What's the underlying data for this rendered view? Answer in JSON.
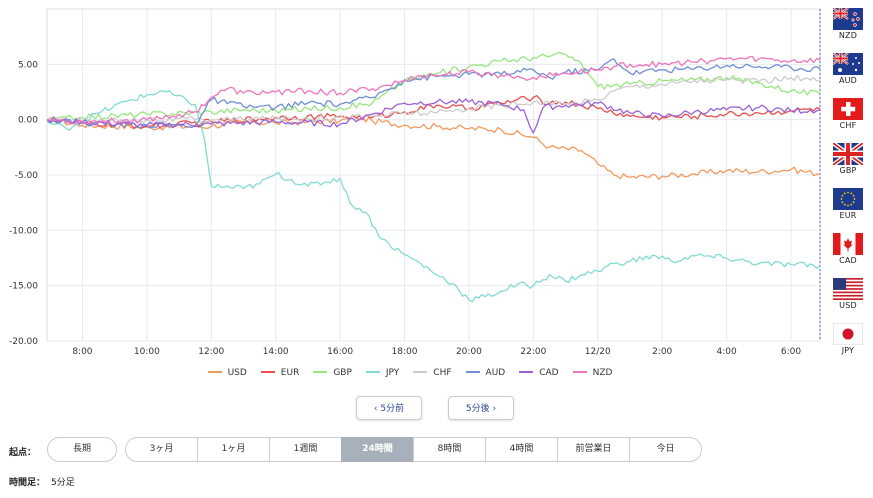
{
  "chart_data": {
    "type": "line",
    "ylim": [
      -20,
      10
    ],
    "y_ticks": [
      "5.00",
      "0.00",
      "-5.00",
      "-10.00",
      "-15.00",
      "-20.00"
    ],
    "y_tick_values": [
      5,
      0,
      -5,
      -10,
      -15,
      -20
    ],
    "x_ticks": [
      "8:00",
      "10:00",
      "12:00",
      "14:00",
      "16:00",
      "18:00",
      "20:00",
      "22:00",
      "12/20",
      "2:00",
      "4:00",
      "6:00"
    ],
    "x_range_hours": [
      6.9,
      30.9
    ],
    "grid": true,
    "legend_position": "bottom",
    "series": [
      {
        "name": "USD",
        "color": "#f29a5e",
        "points": [
          [
            6.9,
            0
          ],
          [
            8,
            -0.5
          ],
          [
            10,
            -0.7
          ],
          [
            12,
            -0.6
          ],
          [
            13,
            -0.2
          ],
          [
            14,
            -0.3
          ],
          [
            15,
            -0.2
          ],
          [
            16,
            -0.1
          ],
          [
            16.5,
            0.2
          ],
          [
            17,
            -0.1
          ],
          [
            18,
            -0.5
          ],
          [
            19,
            -0.6
          ],
          [
            20,
            -0.8
          ],
          [
            21,
            -0.9
          ],
          [
            22,
            -1.6
          ],
          [
            22.5,
            -2.5
          ],
          [
            23.5,
            -2.8
          ],
          [
            24,
            -4.0
          ],
          [
            24.5,
            -5.0
          ],
          [
            25,
            -5.2
          ],
          [
            26,
            -5.1
          ],
          [
            27,
            -4.9
          ],
          [
            28,
            -4.6
          ],
          [
            29,
            -4.7
          ],
          [
            30,
            -4.5
          ],
          [
            30.9,
            -4.9
          ]
        ]
      },
      {
        "name": "EUR",
        "color": "#e84e4e",
        "points": [
          [
            6.9,
            0
          ],
          [
            8,
            -0.3
          ],
          [
            10,
            -0.6
          ],
          [
            12,
            -0.2
          ],
          [
            14,
            0.2
          ],
          [
            16,
            0.3
          ],
          [
            17,
            0.2
          ],
          [
            18,
            0.7
          ],
          [
            19,
            1.3
          ],
          [
            20,
            1.0
          ],
          [
            21,
            1.5
          ],
          [
            22,
            2.0
          ],
          [
            22.5,
            1.5
          ],
          [
            23,
            1.6
          ],
          [
            24,
            1.0
          ],
          [
            25,
            0.3
          ],
          [
            26,
            0.2
          ],
          [
            27,
            0.3
          ],
          [
            28,
            0.5
          ],
          [
            29,
            0.6
          ],
          [
            30,
            0.8
          ],
          [
            30.9,
            1.0
          ]
        ]
      },
      {
        "name": "GBP",
        "color": "#98e67f",
        "points": [
          [
            6.9,
            0
          ],
          [
            8,
            0.2
          ],
          [
            10,
            0.5
          ],
          [
            12,
            0.7
          ],
          [
            13,
            0.9
          ],
          [
            14,
            0.8
          ],
          [
            15,
            1.0
          ],
          [
            16,
            1.1
          ],
          [
            17,
            1.5
          ],
          [
            18,
            3.5
          ],
          [
            19,
            4.2
          ],
          [
            20,
            4.8
          ],
          [
            21,
            5.3
          ],
          [
            22,
            5.6
          ],
          [
            23,
            5.9
          ],
          [
            23.5,
            5.0
          ],
          [
            24,
            3.0
          ],
          [
            25,
            3.2
          ],
          [
            26,
            3.5
          ],
          [
            27,
            3.6
          ],
          [
            28,
            3.8
          ],
          [
            29,
            3.3
          ],
          [
            30,
            2.6
          ],
          [
            30.9,
            2.3
          ]
        ]
      },
      {
        "name": "JPY",
        "color": "#82dbd2",
        "points": [
          [
            6.9,
            -0.2
          ],
          [
            7.5,
            -0.8
          ],
          [
            8.5,
            0.6
          ],
          [
            9.5,
            1.8
          ],
          [
            10.5,
            2.6
          ],
          [
            11.5,
            1.4
          ],
          [
            11.8,
            -2.0
          ],
          [
            12,
            -6.0
          ],
          [
            13,
            -6.2
          ],
          [
            13.5,
            -5.8
          ],
          [
            14,
            -4.9
          ],
          [
            15,
            -6.0
          ],
          [
            16,
            -5.3
          ],
          [
            16.3,
            -7.5
          ],
          [
            16.8,
            -8.4
          ],
          [
            17.3,
            -10.8
          ],
          [
            18,
            -12.2
          ],
          [
            18.5,
            -13.0
          ],
          [
            19,
            -14.0
          ],
          [
            19.5,
            -14.8
          ],
          [
            20,
            -16.3
          ],
          [
            20.5,
            -16.0
          ],
          [
            21,
            -15.5
          ],
          [
            21.5,
            -14.9
          ],
          [
            22,
            -15.0
          ],
          [
            22.5,
            -14.0
          ],
          [
            23,
            -14.6
          ],
          [
            23.5,
            -14.0
          ],
          [
            24,
            -13.7
          ],
          [
            24.5,
            -13.0
          ],
          [
            25,
            -12.8
          ],
          [
            25.8,
            -12.3
          ],
          [
            26.3,
            -12.8
          ],
          [
            27,
            -12.3
          ],
          [
            28,
            -12.5
          ],
          [
            29,
            -13.0
          ],
          [
            30,
            -13.1
          ],
          [
            30.9,
            -13.2
          ]
        ]
      },
      {
        "name": "CHF",
        "color": "#cccccc",
        "points": [
          [
            6.9,
            0
          ],
          [
            8,
            -0.1
          ],
          [
            10,
            0.0
          ],
          [
            12,
            0.0
          ],
          [
            14,
            0.1
          ],
          [
            16,
            0.2
          ],
          [
            17,
            0.3
          ],
          [
            18,
            0.6
          ],
          [
            19,
            0.6
          ],
          [
            20,
            1.0
          ],
          [
            21,
            1.3
          ],
          [
            22,
            1.6
          ],
          [
            23,
            1.4
          ],
          [
            24,
            1.8
          ],
          [
            24.5,
            2.6
          ],
          [
            25,
            3.0
          ],
          [
            26,
            3.2
          ],
          [
            27,
            3.5
          ],
          [
            28,
            3.6
          ],
          [
            29,
            3.4
          ],
          [
            30,
            3.8
          ],
          [
            30.9,
            3.5
          ]
        ]
      },
      {
        "name": "AUD",
        "color": "#6f8fd6",
        "points": [
          [
            6.9,
            0
          ],
          [
            8,
            -0.3
          ],
          [
            10,
            -0.5
          ],
          [
            11.5,
            -0.5
          ],
          [
            12,
            1.8
          ],
          [
            13,
            1.2
          ],
          [
            14,
            1.1
          ],
          [
            15,
            1.5
          ],
          [
            16,
            1.4
          ],
          [
            17,
            2.0
          ],
          [
            18,
            3.6
          ],
          [
            19,
            3.9
          ],
          [
            20,
            4.1
          ],
          [
            21,
            4.1
          ],
          [
            22,
            4.5
          ],
          [
            22.5,
            3.8
          ],
          [
            23,
            4.3
          ],
          [
            24,
            4.5
          ],
          [
            24.5,
            5.5
          ],
          [
            25,
            4.2
          ],
          [
            26,
            4.5
          ],
          [
            27,
            4.6
          ],
          [
            28,
            4.9
          ],
          [
            29,
            4.8
          ],
          [
            30,
            4.7
          ],
          [
            30.9,
            4.6
          ]
        ]
      },
      {
        "name": "CAD",
        "color": "#9a62d6",
        "points": [
          [
            6.9,
            0
          ],
          [
            8,
            -0.2
          ],
          [
            10,
            -0.5
          ],
          [
            12,
            -0.4
          ],
          [
            14,
            -0.2
          ],
          [
            16,
            -0.4
          ],
          [
            17,
            0.5
          ],
          [
            18,
            1.5
          ],
          [
            19,
            1.6
          ],
          [
            20,
            1.6
          ],
          [
            21,
            1.4
          ],
          [
            21.7,
            0.9
          ],
          [
            22,
            -1.2
          ],
          [
            22.3,
            1.1
          ],
          [
            23,
            1.3
          ],
          [
            24,
            1.5
          ],
          [
            25,
            0.6
          ],
          [
            26,
            0.3
          ],
          [
            27,
            0.7
          ],
          [
            28,
            0.9
          ],
          [
            29,
            1.1
          ],
          [
            30,
            0.8
          ],
          [
            30.9,
            0.9
          ]
        ]
      },
      {
        "name": "NZD",
        "color": "#ef74bc",
        "points": [
          [
            6.9,
            0
          ],
          [
            8,
            -0.2
          ],
          [
            10,
            0.0
          ],
          [
            11.5,
            0.7
          ],
          [
            12,
            2.0
          ],
          [
            12.5,
            2.8
          ],
          [
            13,
            2.4
          ],
          [
            14,
            2.5
          ],
          [
            15,
            2.6
          ],
          [
            16,
            2.4
          ],
          [
            17,
            2.8
          ],
          [
            18,
            3.5
          ],
          [
            18.5,
            4.0
          ],
          [
            19,
            4.0
          ],
          [
            20,
            4.3
          ],
          [
            21,
            4.0
          ],
          [
            22,
            3.8
          ],
          [
            23,
            4.2
          ],
          [
            24,
            4.5
          ],
          [
            24.5,
            4.8
          ],
          [
            25,
            5.0
          ],
          [
            26,
            5.0
          ],
          [
            27,
            5.2
          ],
          [
            28,
            5.5
          ],
          [
            29,
            5.5
          ],
          [
            30,
            5.3
          ],
          [
            30.9,
            5.4
          ]
        ]
      }
    ]
  },
  "flags": [
    {
      "code": "NZD",
      "icon": "nz-flag-icon"
    },
    {
      "code": "AUD",
      "icon": "au-flag-icon"
    },
    {
      "code": "CHF",
      "icon": "ch-flag-icon"
    },
    {
      "code": "GBP",
      "icon": "gb-flag-icon"
    },
    {
      "code": "EUR",
      "icon": "eu-flag-icon"
    },
    {
      "code": "CAD",
      "icon": "ca-flag-icon"
    },
    {
      "code": "USD",
      "icon": "us-flag-icon"
    },
    {
      "code": "JPY",
      "icon": "jp-flag-icon"
    }
  ],
  "nav": {
    "prev_label": "‹ 5分前",
    "next_label": "5分後 ›"
  },
  "start": {
    "label": "起点：",
    "long_label": "長期",
    "periods": [
      "3ヶ月",
      "1ヶ月",
      "1週間",
      "24時間",
      "8時間",
      "4時間",
      "前営業日",
      "今日"
    ],
    "selected": "24時間"
  },
  "footer": {
    "label": "時間足：",
    "value": "5分足"
  }
}
